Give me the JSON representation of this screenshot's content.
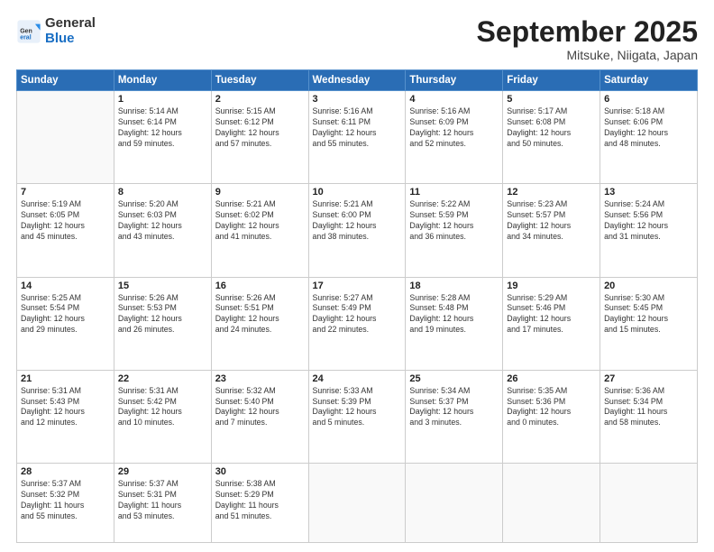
{
  "logo": {
    "general": "General",
    "blue": "Blue"
  },
  "header": {
    "month": "September 2025",
    "location": "Mitsuke, Niigata, Japan"
  },
  "weekdays": [
    "Sunday",
    "Monday",
    "Tuesday",
    "Wednesday",
    "Thursday",
    "Friday",
    "Saturday"
  ],
  "weeks": [
    [
      {
        "day": "",
        "info": ""
      },
      {
        "day": "1",
        "info": "Sunrise: 5:14 AM\nSunset: 6:14 PM\nDaylight: 12 hours\nand 59 minutes."
      },
      {
        "day": "2",
        "info": "Sunrise: 5:15 AM\nSunset: 6:12 PM\nDaylight: 12 hours\nand 57 minutes."
      },
      {
        "day": "3",
        "info": "Sunrise: 5:16 AM\nSunset: 6:11 PM\nDaylight: 12 hours\nand 55 minutes."
      },
      {
        "day": "4",
        "info": "Sunrise: 5:16 AM\nSunset: 6:09 PM\nDaylight: 12 hours\nand 52 minutes."
      },
      {
        "day": "5",
        "info": "Sunrise: 5:17 AM\nSunset: 6:08 PM\nDaylight: 12 hours\nand 50 minutes."
      },
      {
        "day": "6",
        "info": "Sunrise: 5:18 AM\nSunset: 6:06 PM\nDaylight: 12 hours\nand 48 minutes."
      }
    ],
    [
      {
        "day": "7",
        "info": "Sunrise: 5:19 AM\nSunset: 6:05 PM\nDaylight: 12 hours\nand 45 minutes."
      },
      {
        "day": "8",
        "info": "Sunrise: 5:20 AM\nSunset: 6:03 PM\nDaylight: 12 hours\nand 43 minutes."
      },
      {
        "day": "9",
        "info": "Sunrise: 5:21 AM\nSunset: 6:02 PM\nDaylight: 12 hours\nand 41 minutes."
      },
      {
        "day": "10",
        "info": "Sunrise: 5:21 AM\nSunset: 6:00 PM\nDaylight: 12 hours\nand 38 minutes."
      },
      {
        "day": "11",
        "info": "Sunrise: 5:22 AM\nSunset: 5:59 PM\nDaylight: 12 hours\nand 36 minutes."
      },
      {
        "day": "12",
        "info": "Sunrise: 5:23 AM\nSunset: 5:57 PM\nDaylight: 12 hours\nand 34 minutes."
      },
      {
        "day": "13",
        "info": "Sunrise: 5:24 AM\nSunset: 5:56 PM\nDaylight: 12 hours\nand 31 minutes."
      }
    ],
    [
      {
        "day": "14",
        "info": "Sunrise: 5:25 AM\nSunset: 5:54 PM\nDaylight: 12 hours\nand 29 minutes."
      },
      {
        "day": "15",
        "info": "Sunrise: 5:26 AM\nSunset: 5:53 PM\nDaylight: 12 hours\nand 26 minutes."
      },
      {
        "day": "16",
        "info": "Sunrise: 5:26 AM\nSunset: 5:51 PM\nDaylight: 12 hours\nand 24 minutes."
      },
      {
        "day": "17",
        "info": "Sunrise: 5:27 AM\nSunset: 5:49 PM\nDaylight: 12 hours\nand 22 minutes."
      },
      {
        "day": "18",
        "info": "Sunrise: 5:28 AM\nSunset: 5:48 PM\nDaylight: 12 hours\nand 19 minutes."
      },
      {
        "day": "19",
        "info": "Sunrise: 5:29 AM\nSunset: 5:46 PM\nDaylight: 12 hours\nand 17 minutes."
      },
      {
        "day": "20",
        "info": "Sunrise: 5:30 AM\nSunset: 5:45 PM\nDaylight: 12 hours\nand 15 minutes."
      }
    ],
    [
      {
        "day": "21",
        "info": "Sunrise: 5:31 AM\nSunset: 5:43 PM\nDaylight: 12 hours\nand 12 minutes."
      },
      {
        "day": "22",
        "info": "Sunrise: 5:31 AM\nSunset: 5:42 PM\nDaylight: 12 hours\nand 10 minutes."
      },
      {
        "day": "23",
        "info": "Sunrise: 5:32 AM\nSunset: 5:40 PM\nDaylight: 12 hours\nand 7 minutes."
      },
      {
        "day": "24",
        "info": "Sunrise: 5:33 AM\nSunset: 5:39 PM\nDaylight: 12 hours\nand 5 minutes."
      },
      {
        "day": "25",
        "info": "Sunrise: 5:34 AM\nSunset: 5:37 PM\nDaylight: 12 hours\nand 3 minutes."
      },
      {
        "day": "26",
        "info": "Sunrise: 5:35 AM\nSunset: 5:36 PM\nDaylight: 12 hours\nand 0 minutes."
      },
      {
        "day": "27",
        "info": "Sunrise: 5:36 AM\nSunset: 5:34 PM\nDaylight: 11 hours\nand 58 minutes."
      }
    ],
    [
      {
        "day": "28",
        "info": "Sunrise: 5:37 AM\nSunset: 5:32 PM\nDaylight: 11 hours\nand 55 minutes."
      },
      {
        "day": "29",
        "info": "Sunrise: 5:37 AM\nSunset: 5:31 PM\nDaylight: 11 hours\nand 53 minutes."
      },
      {
        "day": "30",
        "info": "Sunrise: 5:38 AM\nSunset: 5:29 PM\nDaylight: 11 hours\nand 51 minutes."
      },
      {
        "day": "",
        "info": ""
      },
      {
        "day": "",
        "info": ""
      },
      {
        "day": "",
        "info": ""
      },
      {
        "day": "",
        "info": ""
      }
    ]
  ]
}
